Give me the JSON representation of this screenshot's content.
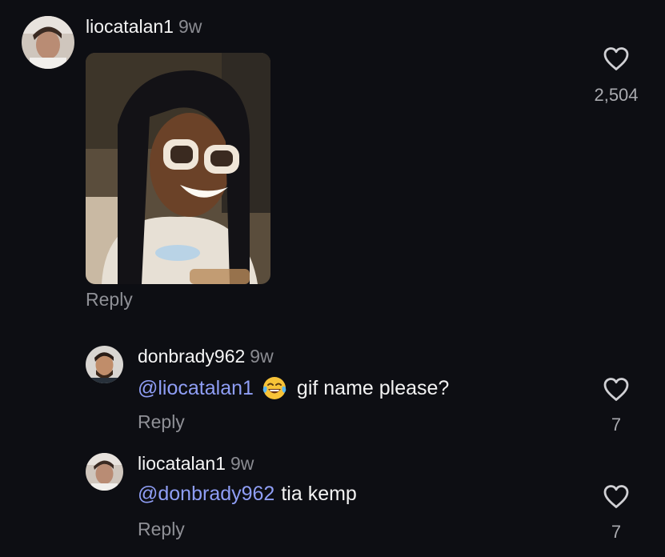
{
  "comments": [
    {
      "username": "liocatalan1",
      "time": "9w",
      "likes": "2,504",
      "reply_label": "Reply",
      "icons": {
        "avatar": "user-avatar",
        "like": "heart-icon",
        "media": "gif-image"
      }
    },
    {
      "username": "donbrady962",
      "time": "9w",
      "mention": "@liocatalan1",
      "emoji": "face-with-tears-of-joy",
      "text": "gif name please?",
      "likes": "7",
      "reply_label": "Reply"
    },
    {
      "username": "liocatalan1",
      "time": "9w",
      "mention": "@donbrady962",
      "text": "tia kemp",
      "likes": "7",
      "reply_label": "Reply"
    }
  ],
  "colors": {
    "background": "#0d0e13",
    "mention": "#8f9ef5",
    "muted": "#8a8b91"
  }
}
